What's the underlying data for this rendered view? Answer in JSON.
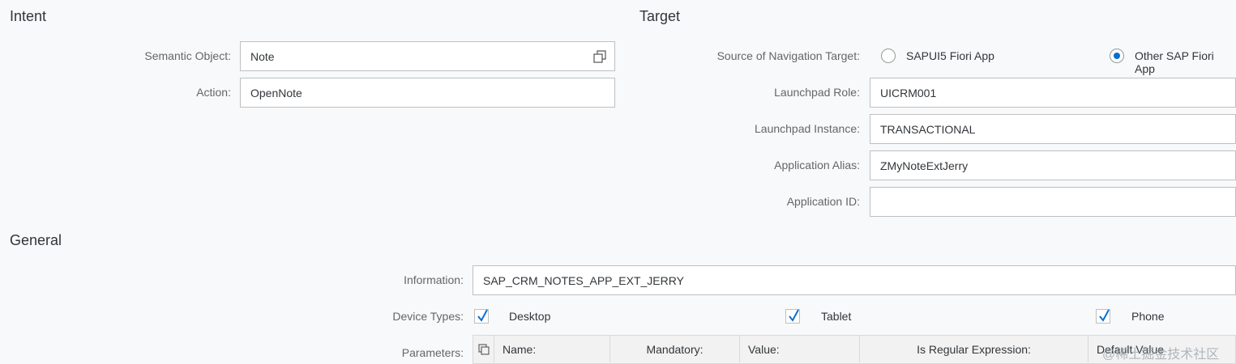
{
  "intent": {
    "title": "Intent",
    "semantic_object": {
      "label": "Semantic Object:",
      "value": "Note",
      "icon": "value-help-icon"
    },
    "action": {
      "label": "Action:",
      "value": "OpenNote"
    }
  },
  "target": {
    "title": "Target",
    "source": {
      "label": "Source of Navigation Target:",
      "options": [
        "SAPUI5 Fiori App",
        "Other SAP Fiori App"
      ],
      "selected": "Other SAP Fiori App"
    },
    "launchpad_role": {
      "label": "Launchpad Role:",
      "value": "UICRM001"
    },
    "launchpad_instance": {
      "label": "Launchpad Instance:",
      "value": "TRANSACTIONAL"
    },
    "application_alias": {
      "label": "Application Alias:",
      "value": "ZMyNoteExtJerry"
    },
    "application_id": {
      "label": "Application ID:",
      "value": ""
    }
  },
  "general": {
    "title": "General",
    "information": {
      "label": "Information:",
      "value": "SAP_CRM_NOTES_APP_EXT_JERRY"
    },
    "device_types": {
      "label": "Device Types:",
      "items": [
        {
          "label": "Desktop",
          "checked": true
        },
        {
          "label": "Tablet",
          "checked": true
        },
        {
          "label": "Phone",
          "checked": true
        }
      ]
    },
    "parameters": {
      "label": "Parameters:",
      "columns": [
        "Name:",
        "Mandatory:",
        "Value:",
        "Is Regular Expression:",
        "Default Value"
      ]
    }
  },
  "watermark": "@稀土掘金技术社区",
  "colors": {
    "accent": "#0a6ed1",
    "check": "#0a6ed1",
    "background": "#f7f9fa"
  }
}
